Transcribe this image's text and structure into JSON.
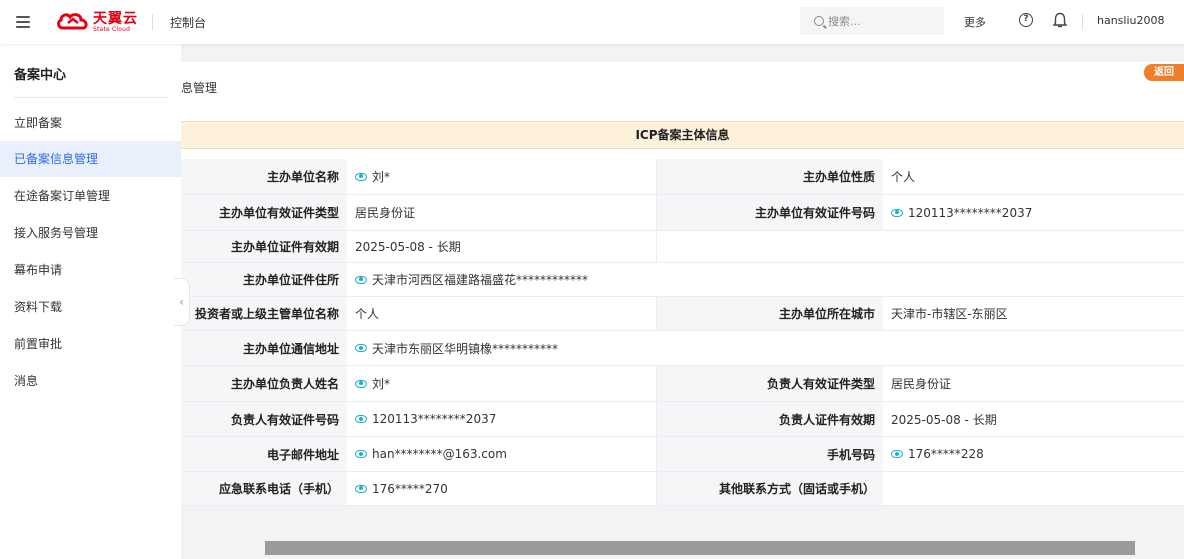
{
  "header": {
    "logo_cn": "天翼云",
    "logo_en": "State Cloud",
    "console": "控制台",
    "search_placeholder": "搜索...",
    "more": "更多",
    "help_glyph": "?",
    "username": "hansliu2008"
  },
  "sidebar": {
    "title": "备案中心",
    "items": [
      {
        "label": "立即备案"
      },
      {
        "label": "已备案信息管理"
      },
      {
        "label": "在途备案订单管理"
      },
      {
        "label": "接入服务号管理"
      },
      {
        "label": "幕布申请"
      },
      {
        "label": "资料下载"
      },
      {
        "label": "前置审批"
      },
      {
        "label": "消息"
      }
    ],
    "collapse_glyph": "‹"
  },
  "main": {
    "breadcrumb": "息管理",
    "back_label": "返回",
    "table_title": "ICP备案主体信息",
    "rows": [
      {
        "l1": "主办单位名称",
        "v1": "刘*",
        "l2": "主办单位性质",
        "v2": "个人"
      },
      {
        "l1": "主办单位有效证件类型",
        "v1": "居民身份证",
        "l2": "主办单位有效证件号码",
        "v2": "120113********2037"
      },
      {
        "l1": "主办单位证件有效期",
        "v1": "2025-05-08 - 长期"
      },
      {
        "l1": "主办单位证件住所",
        "v1": "天津市河西区福建路福盛花************"
      },
      {
        "l1": "投资者或上级主管单位名称",
        "v1": "个人",
        "l2": "主办单位所在城市",
        "v2": "天津市-市辖区-东丽区"
      },
      {
        "l1": "主办单位通信地址",
        "v1": "天津市东丽区华明镇橡***********"
      },
      {
        "l1": "主办单位负责人姓名",
        "v1": "刘*",
        "l2": "负责人有效证件类型",
        "v2": "居民身份证"
      },
      {
        "l1": "负责人有效证件号码",
        "v1": "120113********2037",
        "l2": "负责人证件有效期",
        "v2": "2025-05-08 - 长期"
      },
      {
        "l1": "电子邮件地址",
        "v1": "han********@163.com",
        "l2": "手机号码",
        "v2": "176*****228"
      },
      {
        "l1": "应急联系电话（手机）",
        "v1": "176*****270",
        "l2": "其他联系方式（固话或手机）",
        "v2": ""
      }
    ]
  },
  "colors": {
    "brand_red": "#e60012",
    "active_blue": "#2e6be6",
    "back_orange": "#f07d2a",
    "eye_cyan": "#1ab2c9",
    "table_head_bg": "#fdf1dc"
  }
}
